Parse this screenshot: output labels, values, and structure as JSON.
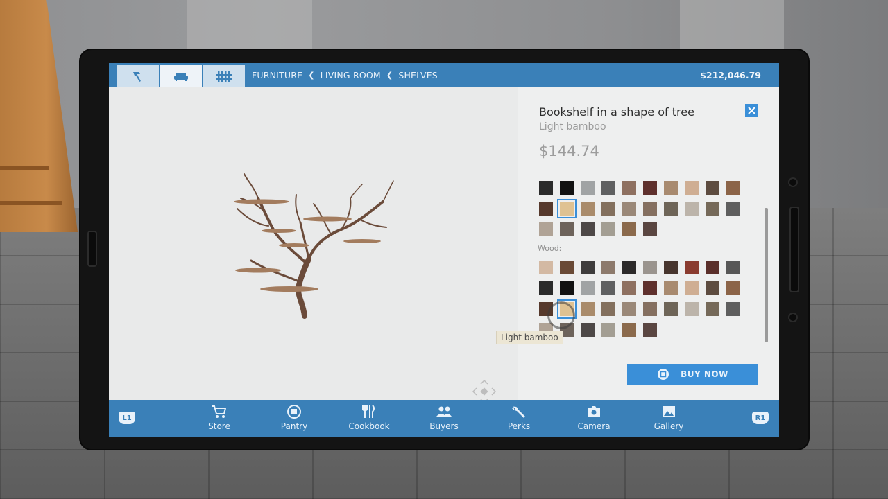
{
  "topbar": {
    "tabs": [
      {
        "icon": "hammer-icon",
        "active": false
      },
      {
        "icon": "sofa-icon",
        "active": true
      },
      {
        "icon": "fence-icon",
        "active": false
      }
    ],
    "breadcrumbs": [
      "FURNITURE",
      "LIVING ROOM",
      "SHELVES"
    ],
    "balance": "$212,046.79"
  },
  "item": {
    "title": "Bookshelf in a shape of tree",
    "variant": "Light bamboo",
    "price": "$144.74"
  },
  "colors": {
    "accent": "#3a8fd8",
    "bar": "#3a80b8"
  },
  "swatches_top": [
    "#2b2b2b",
    "#121212",
    "#a0a3a4",
    "#5f6061",
    "#8e7060",
    "#5e302d",
    "#a88a6f",
    "#cfae93",
    "#5d4c40",
    "#8b6448",
    "#56392c",
    "#dfc292",
    "#a98b6b",
    "#83705e",
    "#9a8878",
    "#857060",
    "#6e6558",
    "#bcb4aa",
    "#756959",
    "#5e5e5e",
    "#b0a396",
    "#6d635b",
    "#4d4847",
    "#a39e93",
    "#8b6a4c",
    "#5a4641"
  ],
  "wood_label": "Wood:",
  "swatches_wood": [
    "#d3b9a3",
    "#6a4a36",
    "#3e3c3c",
    "#8d7a6c",
    "#2c2a2a",
    "#9a948e",
    "#47352e",
    "#8a3b2f",
    "#5a2f2a",
    "#575757",
    "#2b2b2b",
    "#121212",
    "#a0a3a4",
    "#5f6061",
    "#8e7060",
    "#5e302d",
    "#a88a6f",
    "#cfae93",
    "#5d4c40",
    "#8b6448",
    "#56392c",
    "#dfc292",
    "#a98b6b",
    "#83705e",
    "#9a8878",
    "#857060",
    "#6e6558",
    "#bcb4aa",
    "#756959",
    "#5e5e5e",
    "#b0a396",
    "#6d635b",
    "#4d4847",
    "#a39e93",
    "#8b6a4c",
    "#5a4641"
  ],
  "tooltip": "Light bamboo",
  "buy_label": "BUY NOW",
  "bottom_nav": {
    "left_shoulder": "L1",
    "right_shoulder": "R1",
    "items": [
      {
        "label": "Store",
        "icon": "cart-icon"
      },
      {
        "label": "Pantry",
        "icon": "pantry-icon"
      },
      {
        "label": "Cookbook",
        "icon": "cutlery-icon"
      },
      {
        "label": "Buyers",
        "icon": "people-icon"
      },
      {
        "label": "Perks",
        "icon": "wrench-icon"
      },
      {
        "label": "Camera",
        "icon": "camera-icon"
      },
      {
        "label": "Gallery",
        "icon": "image-icon"
      }
    ]
  }
}
